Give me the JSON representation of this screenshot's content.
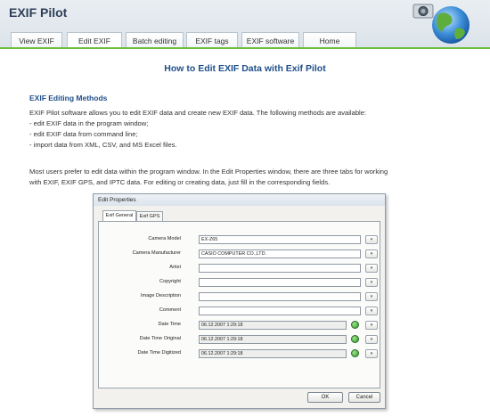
{
  "app": {
    "title": "EXIF Pilot"
  },
  "tabs": [
    {
      "label": "View EXIF"
    },
    {
      "label": "Edit EXIF"
    },
    {
      "label": "Batch editing"
    },
    {
      "label": "EXIF tags"
    },
    {
      "label": "EXIF software"
    },
    {
      "label": "Home"
    }
  ],
  "content": {
    "title": "How to Edit EXIF Data with Exif Pilot",
    "section_title": "EXIF Editing Methods",
    "intro": "EXIF Pilot software allows you to edit EXIF data and create new EXIF data. The following methods are available:",
    "bullets": [
      "- edit EXIF data in the program window;",
      "- edit EXIF data from command line;",
      "- import data from XML, CSV, and MS Excel files."
    ],
    "para2_line1": "Most users prefer to edit data within the program window. In the Edit Properties window, there are three tabs for working",
    "para2_line2": "with EXIF, EXIF GPS, and IPTC data. For editing or creating data, just fill in the corresponding fields."
  },
  "dialog": {
    "title": "Edit Properties",
    "tabs": [
      "Exif General",
      "Exif GPS"
    ],
    "fields": [
      {
        "label": "Camera Model",
        "value": "EX-Z65"
      },
      {
        "label": "Camera Manufacturer",
        "value": "CASIO COMPUTER CO.,LTD."
      },
      {
        "label": "Artist",
        "value": ""
      },
      {
        "label": "Copyright",
        "value": ""
      },
      {
        "label": "Image Description",
        "value": ""
      },
      {
        "label": "Comment",
        "value": ""
      },
      {
        "label": "Date Time",
        "value": "06.12.2007 1:29:18"
      },
      {
        "label": "Date Time Original",
        "value": "06.12.2007 1:29:18"
      },
      {
        "label": "Date Time Digitized",
        "value": "06.12.2007 1:29:18"
      }
    ],
    "ok_label": "OK",
    "cancel_label": "Cancel"
  }
}
